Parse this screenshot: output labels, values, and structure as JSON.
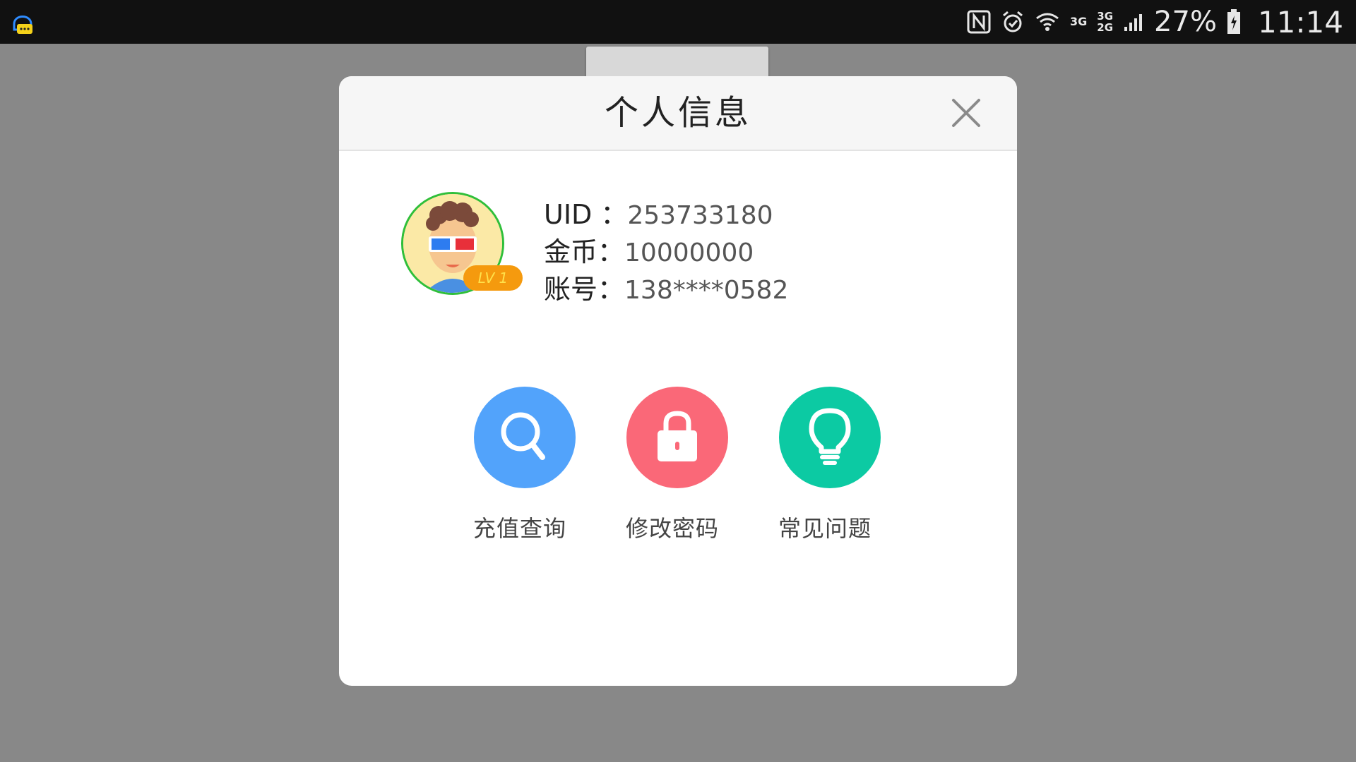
{
  "status_bar": {
    "network_a": "3G",
    "network_b_top": "3G",
    "network_b_bottom": "2G",
    "battery": "27%",
    "time": "11:14"
  },
  "dialog": {
    "title": "个人信息",
    "level": "LV 1",
    "uid_label": "UID ：",
    "uid_value": "253733180",
    "coins_label": "金币：",
    "coins_value": "10000000",
    "account_label": "账号：",
    "account_value": "138****0582",
    "actions": [
      {
        "label": "充值查询",
        "icon": "search-icon",
        "color": "#52a3fb"
      },
      {
        "label": "修改密码",
        "icon": "lock-icon",
        "color": "#fa6878"
      },
      {
        "label": "常见问题",
        "icon": "lightbulb-icon",
        "color": "#0ccaa3"
      }
    ]
  }
}
